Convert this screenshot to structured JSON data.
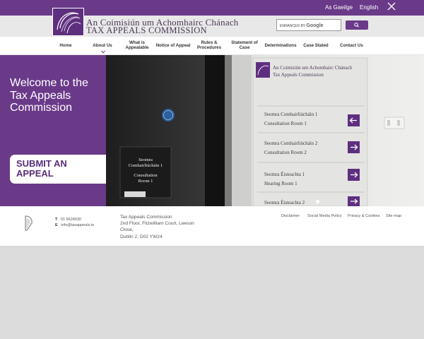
{
  "topbar": {
    "lang_irish": "As Gaeilge",
    "lang_english": "English",
    "social_icon": "x-icon",
    "color": "#6a3a89"
  },
  "header": {
    "logo_icon": "tac-logo-icon",
    "logo_line1": "An Coimisiún um Achomhairc Chánach",
    "logo_line2": "TAX APPEALS COMMISSION",
    "search_prefix": "ENHANCED BY",
    "search_brand": "Google",
    "search_button_icon": "search-icon"
  },
  "nav": {
    "items": [
      {
        "label": "Home"
      },
      {
        "label": "About Us"
      },
      {
        "label": "What is Appealable"
      },
      {
        "label": "Notice of Appeal"
      },
      {
        "label": "Rules & Procedures"
      },
      {
        "label": "Statement of Case"
      },
      {
        "label": "Determinations"
      },
      {
        "label": "Case Stated"
      },
      {
        "label": "Contact Us"
      }
    ],
    "dropdown_icon": "chevron-down-icon"
  },
  "hero": {
    "title": "Welcome to the Tax Appeals Commission",
    "submit_label": "SUBMIT AN APPEAL",
    "accent": "#6a3a89",
    "door_sign": {
      "line1": "Seomra",
      "line2": "Comhairliúcháin 1",
      "line3": "Consultation",
      "line4": "Room 1"
    },
    "wall_sign": {
      "header1": "An Coimisiún um Achomhairc Chánach",
      "header2": "Tax Appeals Commission",
      "rows": [
        {
          "ga": "Seomra Comhairliúcháin 1",
          "en": "Consultation Room 1",
          "arrow": "arrow-left-icon"
        },
        {
          "ga": "Seomra Comhairliúcháin 2",
          "en": "Consultation Room 2",
          "arrow": "arrow-right-icon"
        },
        {
          "ga": "Seomra Éisteachta 1",
          "en": "Hearing Room 1",
          "arrow": "arrow-right-icon"
        },
        {
          "ga": "Seomra Éisteachta 2",
          "en": "",
          "arrow": "arrow-right-icon"
        }
      ]
    }
  },
  "footer": {
    "emblem_icon": "harp-icon",
    "phone_label": "T",
    "phone": "01 6624530",
    "email_label": "E",
    "email": "info@taxappeals.ie",
    "address_line1": "Tax Appeals Commission",
    "address_line2": "2nd Floor, Fitzwilliam Court, Leeson Close,",
    "address_line3": "Dublin 2, D02 YW24",
    "links": [
      {
        "label": "Disclaimer"
      },
      {
        "label": "Social Media Policy"
      },
      {
        "label": "Privacy & Cookies"
      },
      {
        "label": "Site map"
      }
    ]
  }
}
